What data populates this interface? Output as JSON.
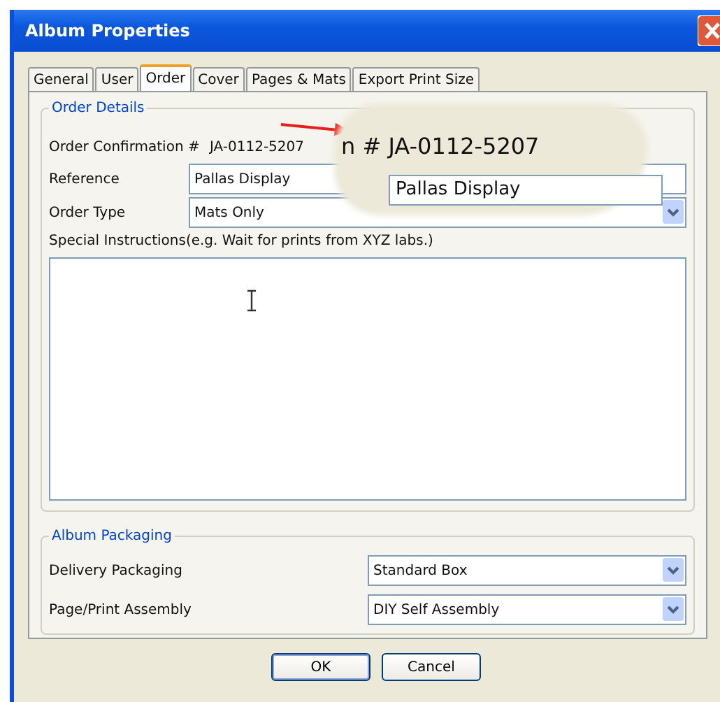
{
  "window": {
    "title": "Album Properties"
  },
  "tabs": [
    {
      "label": "General",
      "selected": false
    },
    {
      "label": "User",
      "selected": false
    },
    {
      "label": "Order",
      "selected": true
    },
    {
      "label": "Cover",
      "selected": false
    },
    {
      "label": "Pages & Mats",
      "selected": false
    },
    {
      "label": "Export Print Size",
      "selected": false
    }
  ],
  "order_details": {
    "title": "Order Details",
    "confirmation_label": "Order Confirmation #",
    "confirmation_value": "JA-0112-5207",
    "reference_label": "Reference",
    "reference_value": "Pallas Display",
    "order_type_label": "Order Type",
    "order_type_value": "Mats Only",
    "instructions_label": "Special Instructions(e.g. Wait for prints from XYZ labs.)"
  },
  "magnifier": {
    "text": "n # JA-0112-5207",
    "field_text": "Pallas Display"
  },
  "album_packaging": {
    "title": "Album Packaging",
    "rows": [
      {
        "label": "Delivery Packaging",
        "value": "Standard Box"
      },
      {
        "label": "Page/Print Assembly",
        "value": "DIY Self Assembly"
      }
    ]
  },
  "buttons": [
    {
      "label": "OK",
      "kind": "default"
    },
    {
      "label": "Cancel",
      "kind": "normal"
    }
  ]
}
